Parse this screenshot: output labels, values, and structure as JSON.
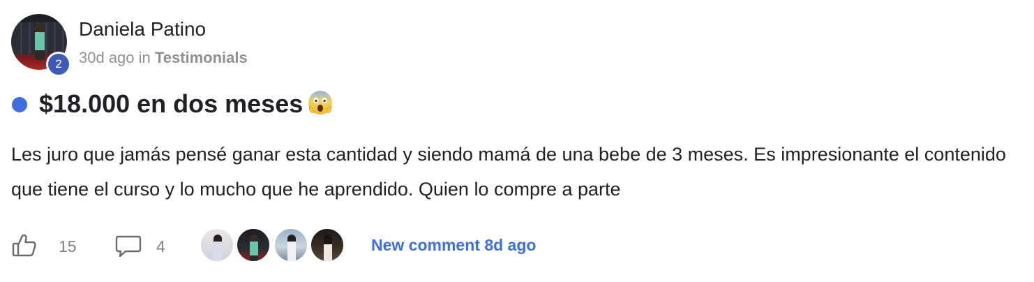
{
  "post": {
    "author": {
      "name": "Daniela Patino",
      "level": "2",
      "avatar": "profile-photo"
    },
    "meta": {
      "time": "30d ago",
      "in_word": "in",
      "category": "Testimonials"
    },
    "title": "$18.000 en dos meses",
    "title_emoji": "face-screaming-in-fear-emoji",
    "body": "Les juro que jamás pensé ganar esta cantidad y siendo mamá de una bebe de 3 meses. Es impresionante el contenido que tiene el curso y lo mucho que he aprendido. Quien lo compre a parte",
    "likes": "15",
    "comments": "4",
    "new_comment": "New comment 8d ago",
    "colors": {
      "accent": "#3d6fe0",
      "level_badge": "#3d5ab4",
      "muted": "#909090"
    },
    "icons": {
      "like": "thumbs-up-icon",
      "comment": "comment-bubble-icon"
    }
  }
}
